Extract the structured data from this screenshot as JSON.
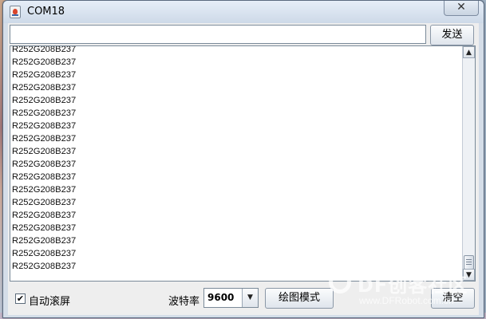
{
  "window": {
    "title": "COM18",
    "close_label": "✕"
  },
  "toolbar": {
    "send_value": "",
    "send_label": "发送"
  },
  "output": {
    "lines": [
      "R252G208B237",
      "R252G208B237",
      "R252G208B237",
      "R252G208B237",
      "R252G208B237",
      "R252G208B237",
      "R252G208B237",
      "R252G208B237",
      "R252G208B237",
      "R252G208B237",
      "R252G208B237",
      "R252G208B237",
      "R252G208B237",
      "R252G208B237",
      "R252G208B237",
      "R252G208B237",
      "R252G208B237",
      "R252G208B237"
    ]
  },
  "footer": {
    "autoscroll_checked": true,
    "autoscroll_label": "自动滚屏",
    "baud_label": "波特率",
    "baud_value": "9600",
    "plot_label": "绘图模式",
    "clear_label": "清空"
  },
  "watermark": {
    "brand": "DF创客社区",
    "url": "www.DFRobot.com.cn"
  }
}
